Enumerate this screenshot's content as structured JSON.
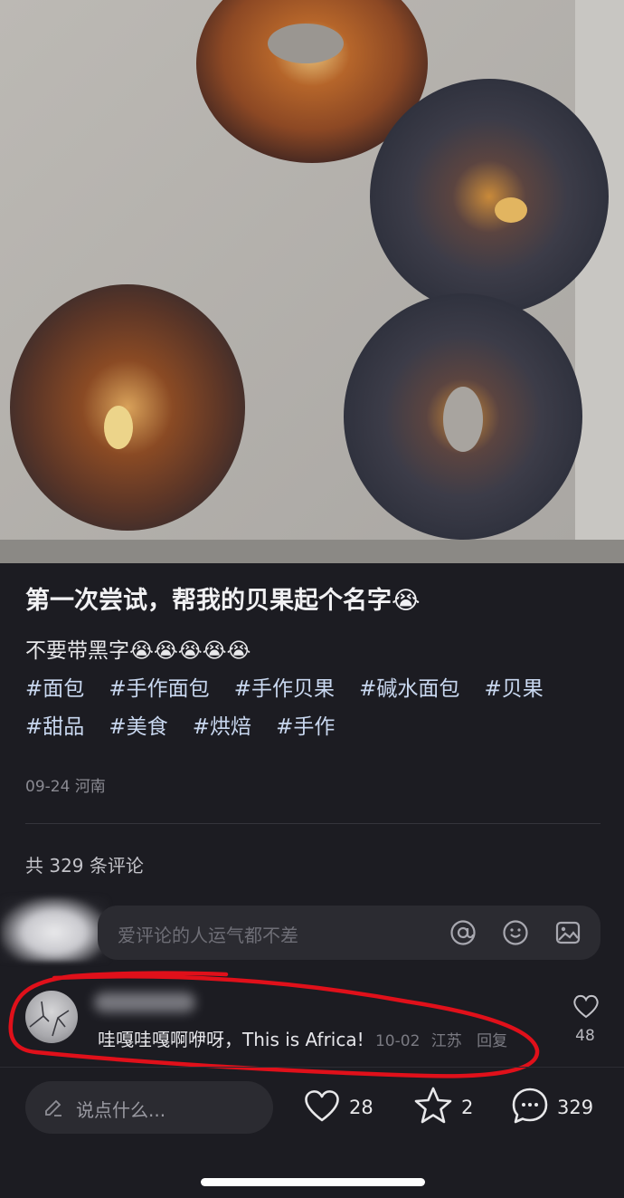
{
  "post": {
    "title": "第一次尝试，帮我的贝果起个名字😭",
    "body": "不要带黑字😭😭😭😭😭",
    "tags": [
      "#面包",
      "#手作面包",
      "#手作贝果",
      "#碱水面包",
      "#贝果",
      "#甜品",
      "#美食",
      "#烘焙",
      "#手作"
    ],
    "date": "09-24",
    "location": "河南"
  },
  "comments": {
    "count_label": "共 329 条评论",
    "input_placeholder": "爱评论的人运气都不差",
    "items": [
      {
        "text": "哇嘎哇嘎啊咿呀，This is Africa!",
        "date": "10-02",
        "location": "江苏",
        "reply_label": "回复",
        "likes": "48"
      }
    ]
  },
  "bottom_bar": {
    "say_placeholder": "说点什么...",
    "likes": "28",
    "favorites": "2",
    "comments": "329"
  },
  "icons": [
    "at-icon",
    "emoji-icon",
    "image-icon",
    "heart-icon",
    "star-icon",
    "comment-bubble-icon",
    "pen-icon"
  ],
  "colors": {
    "background": "#1c1c22",
    "tag": "#c9d8f0",
    "annotation": "#e0101a"
  }
}
